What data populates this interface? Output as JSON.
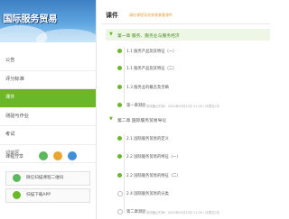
{
  "banner": {
    "title": "国际服务贸易"
  },
  "menu": {
    "items": [
      {
        "label": "公告"
      },
      {
        "label": "评分标准"
      },
      {
        "label": "课件"
      },
      {
        "label": "测验与作业"
      },
      {
        "label": "考试"
      },
      {
        "label": "讨论区"
      }
    ]
  },
  "share": {
    "label": "课程分享"
  },
  "apps": [
    {
      "label": "微信扫描课程二维码"
    },
    {
      "label": "扫描下载APP"
    }
  ],
  "main": {
    "title": "课件",
    "tip": "请在课程导览系统查看课件"
  },
  "chapters": [
    {
      "title": "第一章 服务、服务业与服务经济",
      "lessons": [
        {
          "label": "1.1 服务产品及其特征（一）",
          "meta": ""
        },
        {
          "label": "1.1 服务产品及其特征（二）",
          "meta": ""
        },
        {
          "label": "1.3 服务业的概念及范畴",
          "meta": ""
        },
        {
          "label": "第一章测验",
          "meta": "测试截止时间：2020年03月10日 21:30 / 可提交2次"
        }
      ]
    },
    {
      "title": "第二章 国际服务贸易导论",
      "lessons": [
        {
          "label": "2.1 国际服务贸易的定义",
          "meta": ""
        },
        {
          "label": "2.2 国际服务贸易的特征（一）",
          "meta": ""
        },
        {
          "label": "2.2 国际服务贸易的特征（二）",
          "meta": ""
        },
        {
          "label": "2.4 国际服务贸易的分类",
          "meta": ""
        },
        {
          "label": "第二章测验",
          "meta": "测试截止时间：2020年03月20日 21:30 / 可提交2次"
        }
      ]
    }
  ],
  "colors": {
    "accent": "#6ab82a",
    "tip": "#e89a2b"
  }
}
